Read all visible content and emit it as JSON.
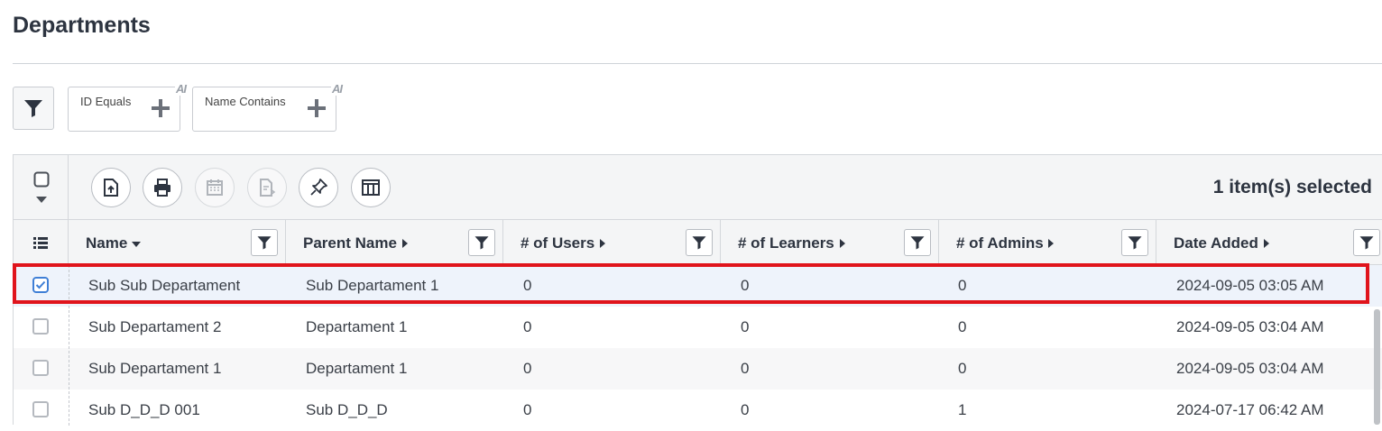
{
  "page": {
    "title": "Departments"
  },
  "filters": {
    "chips": [
      {
        "label": "ID Equals",
        "ai_badge": "AI"
      },
      {
        "label": "Name Contains",
        "ai_badge": "AI"
      }
    ]
  },
  "toolbar": {
    "icons": [
      "export-icon",
      "print-icon",
      "calendar-icon",
      "report-icon",
      "pin-icon",
      "columns-icon"
    ],
    "selected_text": "1 item(s) selected"
  },
  "columns": [
    {
      "label": "Name",
      "sort": "desc"
    },
    {
      "label": "Parent Name",
      "sort": "none"
    },
    {
      "label": "# of Users",
      "sort": "none"
    },
    {
      "label": "# of Learners",
      "sort": "none"
    },
    {
      "label": "# of Admins",
      "sort": "none"
    },
    {
      "label": "Date Added",
      "sort": "none"
    }
  ],
  "rows": [
    {
      "checked": true,
      "cells": [
        "Sub Sub Departament",
        "Sub Departament 1",
        "0",
        "0",
        "0",
        "2024-09-05 03:05 AM"
      ]
    },
    {
      "checked": false,
      "cells": [
        "Sub Departament 2",
        "Departament 1",
        "0",
        "0",
        "0",
        "2024-09-05 03:04 AM"
      ]
    },
    {
      "checked": false,
      "cells": [
        "Sub Departament 1",
        "Departament 1",
        "0",
        "0",
        "0",
        "2024-09-05 03:04 AM"
      ]
    },
    {
      "checked": false,
      "cells": [
        "Sub D_D_D 001",
        "Sub D_D_D",
        "0",
        "0",
        "1",
        "2024-07-17 06:42 AM"
      ]
    }
  ],
  "colors": {
    "accent": "#3f7fd6",
    "highlight": "#e0141c",
    "title": "#2d3440"
  }
}
